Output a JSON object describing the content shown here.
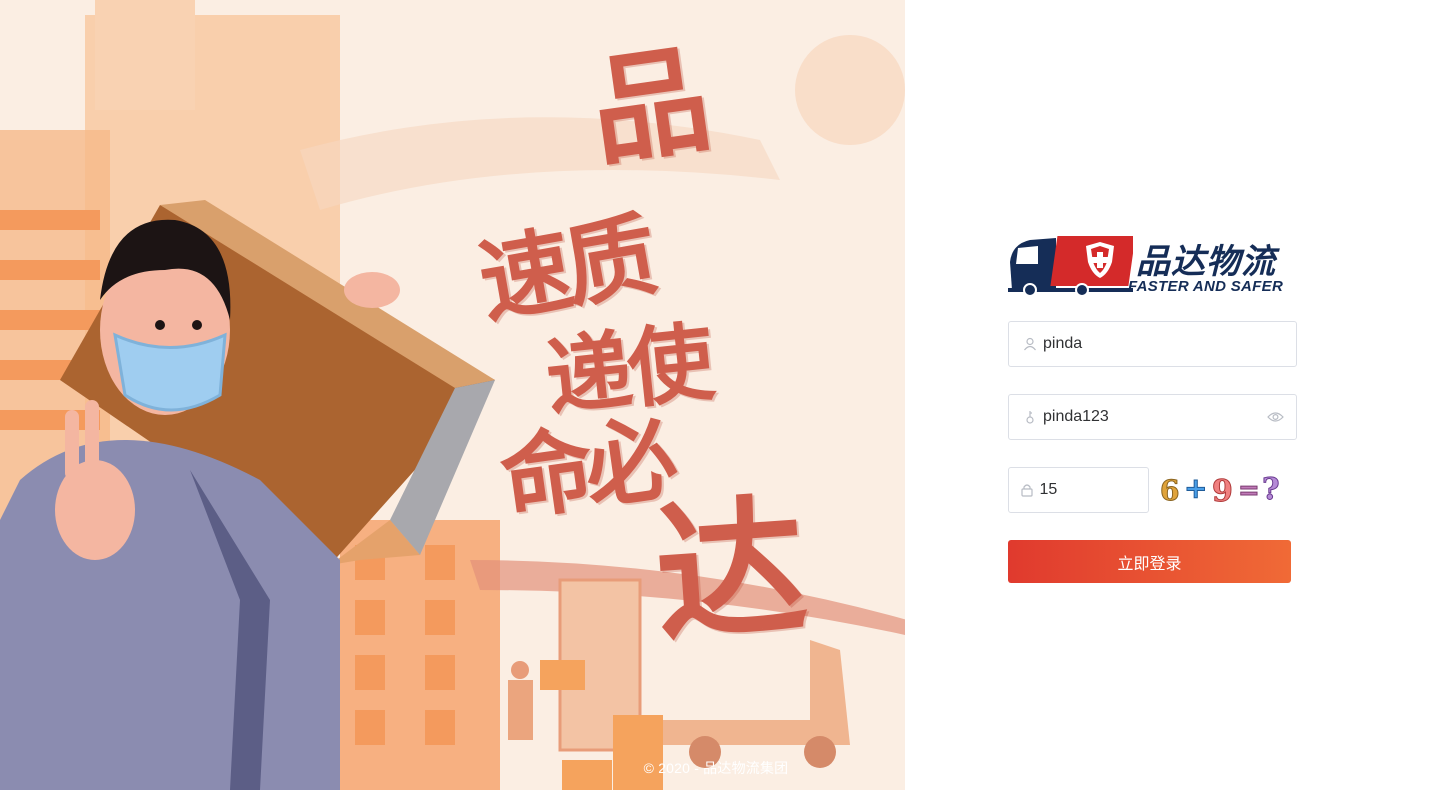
{
  "hero": {
    "slogan_lines": [
      "品",
      "速质",
      "递使",
      "命必",
      "达"
    ]
  },
  "brand": {
    "name_cn": "品达物流",
    "tagline": "FASTER AND SAFER"
  },
  "form": {
    "username_value": "pinda",
    "password_value": "pinda123",
    "captcha_value": "15",
    "captcha_glyphs": [
      "6",
      "+",
      "9",
      "=",
      "?"
    ],
    "submit_label": "立即登录"
  },
  "footer": {
    "copyright": "© 2020 - 品达物流集团"
  },
  "colors": {
    "accent_start": "#e03a2e",
    "accent_end": "#f06a36",
    "brand_navy": "#152d57",
    "brand_red": "#d42a2a",
    "calligraphy": "#cf5e4c"
  }
}
